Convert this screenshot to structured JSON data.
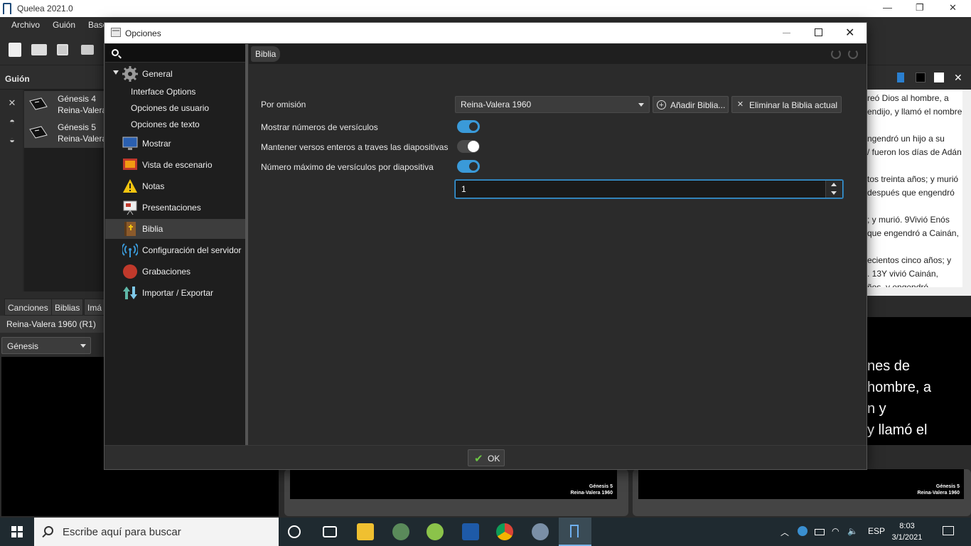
{
  "app": {
    "title": "Quelea 2021.0",
    "window_controls": {
      "minimize": "—",
      "restore": "❐",
      "close": "✕"
    },
    "menu": [
      "Archivo",
      "Guión",
      "Base"
    ],
    "schedule": {
      "title": "Guión",
      "items": [
        {
          "title": "Génesis 4",
          "subtitle": "Reina-Valera"
        },
        {
          "title": "Génesis 5",
          "subtitle": "Reina-Valera"
        }
      ]
    },
    "library": {
      "tabs": [
        "Canciones",
        "Biblias",
        "Imá"
      ],
      "version": "Reina-Valera 1960 (R1)",
      "book": "Génesis"
    },
    "live_text_lines": [
      "reó Dios al hombre,  a",
      "endijo,  y llamó el nombre",
      "",
      "ngendró un hijo a su",
      "/ fueron los días de Adán",
      "",
      "tos treinta años;  y murió",
      " después que engendró",
      "",
      ";  y murió. 9Vivió Enós",
      "que engendró a Cainán,",
      "",
      "ecientos cinco años;  y",
      ". 13Y vivió Cainán,",
      "ños,  y engendró"
    ],
    "live_display_lines": [
      "nes de",
      "hombre,  a",
      "n y",
      "y llamó el"
    ],
    "thumb_caption": [
      "Génesis 5",
      "Reina-Valera 1960"
    ]
  },
  "dialog": {
    "title": "Opciones",
    "window_controls": {
      "close": "✕"
    },
    "nav": {
      "general": "General",
      "sub_items": [
        "Interface Options",
        "Opciones de usuario",
        "Opciones de texto"
      ],
      "items": [
        {
          "label": "Mostrar",
          "icon": "monitor-icon",
          "color": "#2a5fb0"
        },
        {
          "label": "Vista de escenario",
          "icon": "stage-icon",
          "color": "#c0392b"
        },
        {
          "label": "Notas",
          "icon": "warning-icon",
          "color": "#f2c40f"
        },
        {
          "label": "Presentaciones",
          "icon": "presentation-icon",
          "color": "#e8e8e8"
        },
        {
          "label": "Biblia",
          "icon": "bible-icon",
          "color": "#8b5a2b"
        },
        {
          "label": "Configuración del servidor",
          "icon": "broadcast-icon",
          "color": "#3a9ad9"
        },
        {
          "label": "Grabaciones",
          "icon": "record-icon",
          "color": "#c0392b"
        },
        {
          "label": "Importar / Exportar",
          "icon": "import-export-icon",
          "color": "#5fb8a8"
        }
      ],
      "selected": "Biblia"
    },
    "breadcrumb": "Biblia",
    "bible": {
      "default_label": "Por omisión",
      "default_value": "Reina-Valera 1960",
      "add_button": "Añadir Biblia...",
      "remove_button": "Eliminar la Biblia actual",
      "show_verse_numbers_label": "Mostrar números de versículos",
      "show_verse_numbers": true,
      "keep_verses_label": "Mantener versos enteros a traves las diapositivas",
      "keep_verses": false,
      "max_verses_label": "Número máximo de versículos por diapositiva",
      "max_verses_enabled": true,
      "max_verses_value": "1"
    },
    "ok_button": "OK",
    "accent_color": "#3a9ad9"
  },
  "taskbar": {
    "search_placeholder": "Escribe aquí para buscar",
    "language": "ESP",
    "time": "8:03",
    "date": "3/1/2021"
  }
}
